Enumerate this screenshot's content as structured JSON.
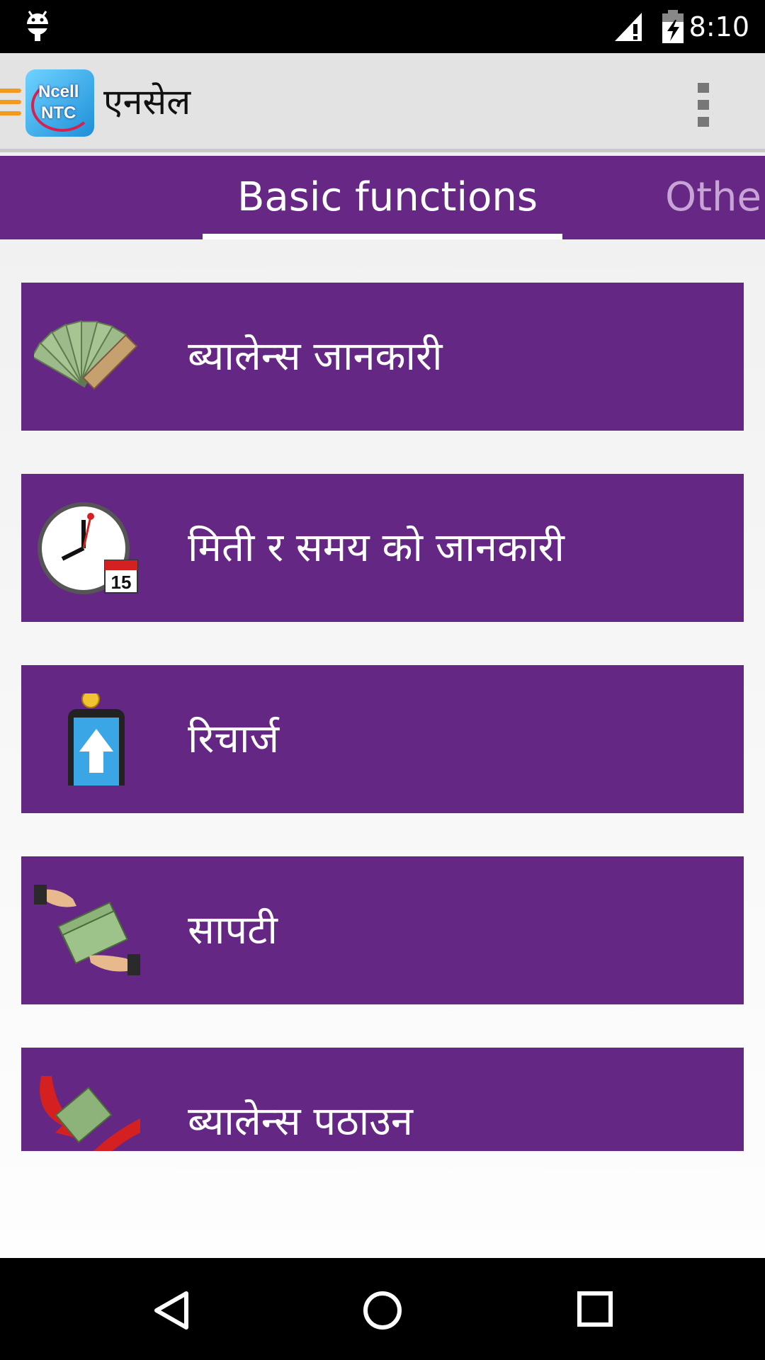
{
  "status_bar": {
    "time": "8:10",
    "icons": [
      "android-debug-icon",
      "signal-icon",
      "battery-charging-icon"
    ]
  },
  "app_bar": {
    "title": "एनसेल",
    "logo_text_top": "Ncell",
    "logo_text_bottom": "NTC",
    "icons": [
      "drawer-menu-icon",
      "app-logo",
      "overflow-menu-icon"
    ]
  },
  "tabs": [
    {
      "label": "Basic functions",
      "selected": true
    },
    {
      "label": "Other",
      "selected": false
    }
  ],
  "items": [
    {
      "label": "ब्यालेन्स जानकारी",
      "icon": "money-fan-icon"
    },
    {
      "label": "मिती र समय को जानकारी",
      "icon": "clock-calendar-icon"
    },
    {
      "label": "रिचार्ज",
      "icon": "phone-recharge-icon"
    },
    {
      "label": "सापटी",
      "icon": "money-exchange-icon"
    },
    {
      "label": "ब्यालेन्स पठाउन",
      "icon": "money-send-icon"
    }
  ],
  "calendar_day": "15",
  "nav_bar": {
    "icons": [
      "back-icon",
      "home-icon",
      "recents-icon"
    ]
  },
  "colors": {
    "primary": "#652784",
    "tab_unselected": "#c7a3d6",
    "drawer_accent": "#f29a1e"
  }
}
